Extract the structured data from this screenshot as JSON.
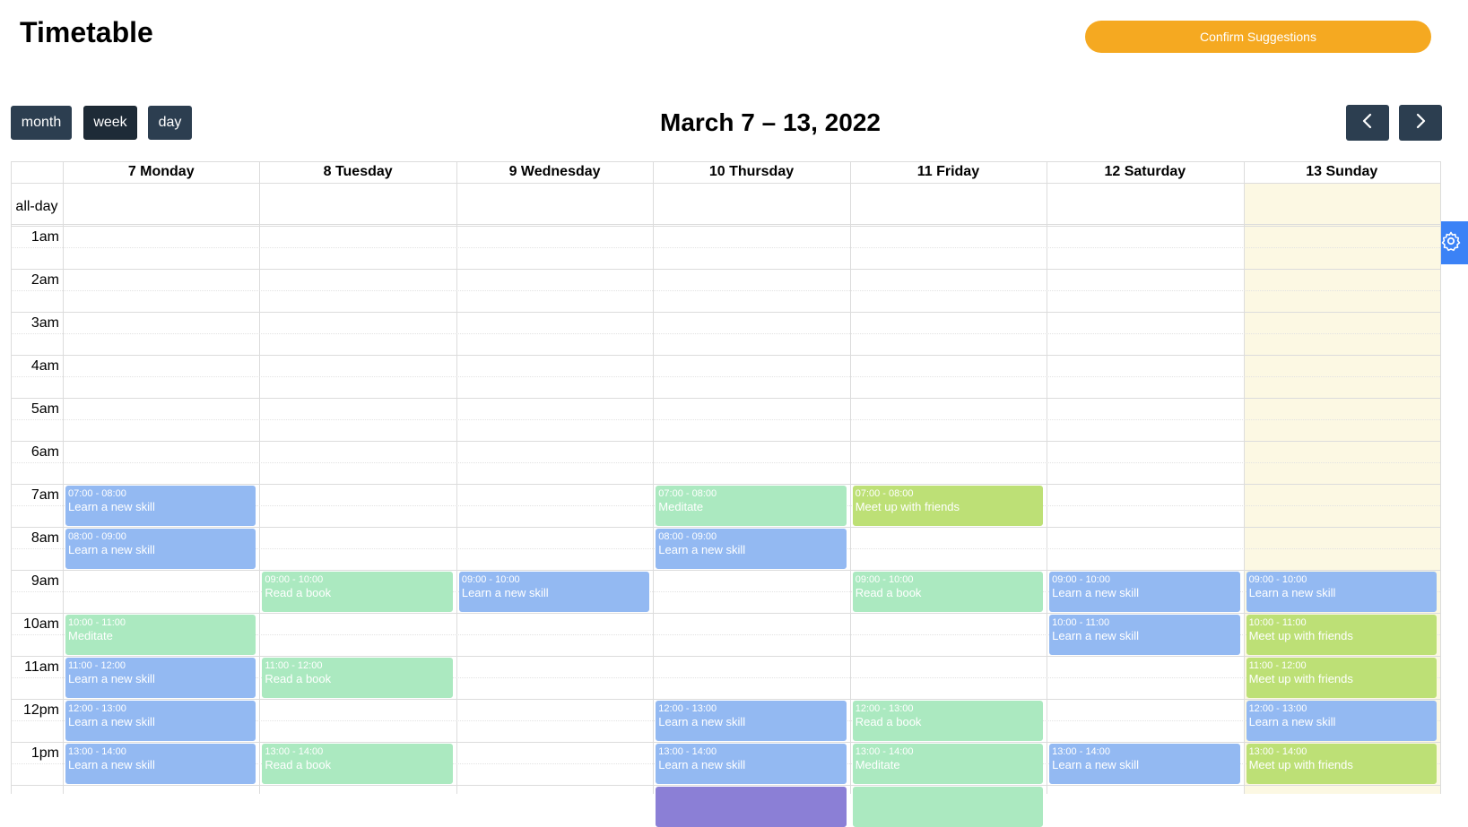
{
  "header": {
    "title": "Timetable",
    "confirm_label": "Confirm Suggestions"
  },
  "toolbar": {
    "views": [
      "month",
      "week",
      "day"
    ],
    "active_view": "week",
    "range_title": "March 7 – 13, 2022",
    "prev_icon": "chevron-left-icon",
    "next_icon": "chevron-right-icon"
  },
  "settings": {
    "icon": "gear-icon"
  },
  "calendar": {
    "all_day_label": "all-day",
    "days": [
      "7 Monday",
      "8 Tuesday",
      "9 Wednesday",
      "10 Thursday",
      "11 Friday",
      "12 Saturday",
      "13 Sunday"
    ],
    "today_index": 6,
    "hours": [
      "1am",
      "2am",
      "3am",
      "4am",
      "5am",
      "6am",
      "7am",
      "8am",
      "9am",
      "10am",
      "11am",
      "12pm",
      "1pm"
    ],
    "events": [
      {
        "day": 0,
        "start": 7,
        "time": "07:00 - 08:00",
        "title": "Learn a new skill",
        "kind": "skill"
      },
      {
        "day": 0,
        "start": 8,
        "time": "08:00 - 09:00",
        "title": "Learn a new skill",
        "kind": "skill"
      },
      {
        "day": 0,
        "start": 10,
        "time": "10:00 - 11:00",
        "title": "Meditate",
        "kind": "green"
      },
      {
        "day": 0,
        "start": 11,
        "time": "11:00 - 12:00",
        "title": "Learn a new skill",
        "kind": "skill"
      },
      {
        "day": 0,
        "start": 12,
        "time": "12:00 - 13:00",
        "title": "Learn a new skill",
        "kind": "skill"
      },
      {
        "day": 0,
        "start": 13,
        "time": "13:00 - 14:00",
        "title": "Learn a new skill",
        "kind": "skill"
      },
      {
        "day": 1,
        "start": 9,
        "time": "09:00 - 10:00",
        "title": "Read a book",
        "kind": "green"
      },
      {
        "day": 1,
        "start": 11,
        "time": "11:00 - 12:00",
        "title": "Read a book",
        "kind": "green"
      },
      {
        "day": 1,
        "start": 13,
        "time": "13:00 - 14:00",
        "title": "Read a book",
        "kind": "green"
      },
      {
        "day": 2,
        "start": 9,
        "time": "09:00 - 10:00",
        "title": "Learn a new skill",
        "kind": "skill"
      },
      {
        "day": 3,
        "start": 7,
        "time": "07:00 - 08:00",
        "title": "Meditate",
        "kind": "green"
      },
      {
        "day": 3,
        "start": 8,
        "time": "08:00 - 09:00",
        "title": "Learn a new skill",
        "kind": "skill"
      },
      {
        "day": 3,
        "start": 12,
        "time": "12:00 - 13:00",
        "title": "Learn a new skill",
        "kind": "skill"
      },
      {
        "day": 3,
        "start": 13,
        "time": "13:00 - 14:00",
        "title": "Learn a new skill",
        "kind": "skill"
      },
      {
        "day": 3,
        "start": 14,
        "time": "",
        "title": "",
        "kind": "purple"
      },
      {
        "day": 4,
        "start": 7,
        "time": "07:00 - 08:00",
        "title": "Meet up with friends",
        "kind": "lime"
      },
      {
        "day": 4,
        "start": 9,
        "time": "09:00 - 10:00",
        "title": "Read a book",
        "kind": "green"
      },
      {
        "day": 4,
        "start": 12,
        "time": "12:00 - 13:00",
        "title": "Read a book",
        "kind": "green"
      },
      {
        "day": 4,
        "start": 13,
        "time": "13:00 - 14:00",
        "title": "Meditate",
        "kind": "green"
      },
      {
        "day": 4,
        "start": 14,
        "time": "",
        "title": "",
        "kind": "green"
      },
      {
        "day": 5,
        "start": 9,
        "time": "09:00 - 10:00",
        "title": "Learn a new skill",
        "kind": "skill"
      },
      {
        "day": 5,
        "start": 10,
        "time": "10:00 - 11:00",
        "title": "Learn a new skill",
        "kind": "skill"
      },
      {
        "day": 5,
        "start": 13,
        "time": "13:00 - 14:00",
        "title": "Learn a new skill",
        "kind": "skill"
      },
      {
        "day": 6,
        "start": 9,
        "time": "09:00 - 10:00",
        "title": "Learn a new skill",
        "kind": "skill"
      },
      {
        "day": 6,
        "start": 10,
        "time": "10:00 - 11:00",
        "title": "Meet up with friends",
        "kind": "lime"
      },
      {
        "day": 6,
        "start": 11,
        "time": "11:00 - 12:00",
        "title": "Meet up with friends",
        "kind": "lime"
      },
      {
        "day": 6,
        "start": 12,
        "time": "12:00 - 13:00",
        "title": "Learn a new skill",
        "kind": "skill"
      },
      {
        "day": 6,
        "start": 13,
        "time": "13:00 - 14:00",
        "title": "Meet up with friends",
        "kind": "lime"
      }
    ]
  },
  "colors": {
    "accent": "#f5a921",
    "button": "#2c3e50",
    "settings": "#3b82f6",
    "today": "#fcf8e3",
    "skill": "#93b9f2",
    "green": "#abe9c0",
    "lime": "#bde076",
    "purple": "#8b7fd6"
  }
}
